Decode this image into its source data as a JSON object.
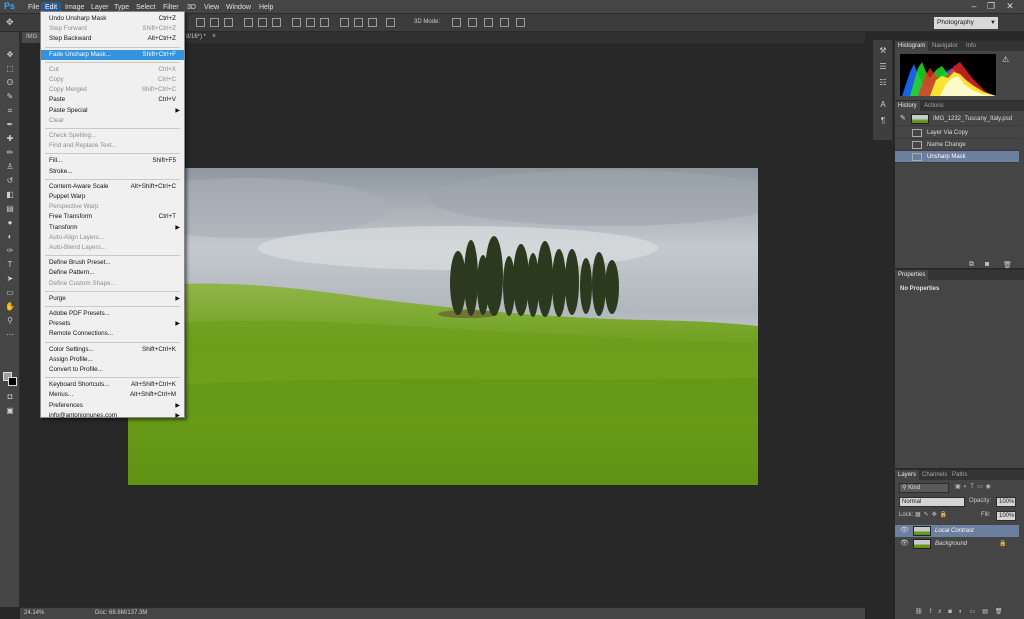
{
  "app": {
    "logo": "Ps"
  },
  "menubar": {
    "items": [
      "File",
      "Edit",
      "Image",
      "Layer",
      "Type",
      "Select",
      "Filter",
      "3D",
      "View",
      "Window",
      "Help"
    ],
    "active": "Edit",
    "window_controls": [
      "minimize-icon",
      "restore-icon",
      "close-icon"
    ]
  },
  "options_bar": {
    "mode_3d_label": "3D Mode:",
    "workspace": "Photography"
  },
  "document": {
    "tab_left": "IMG",
    "tab_right": "8/16*) *",
    "zoom": "24.14%",
    "doc_info": "Doc: 68.6M/137.3M"
  },
  "edit_menu": {
    "items": [
      {
        "label": "Undo Unsharp Mask",
        "shortcut": "Ctrl+Z",
        "state": "enabled"
      },
      {
        "label": "Step Forward",
        "shortcut": "Shift+Ctrl+Z",
        "state": "disabled"
      },
      {
        "label": "Step Backward",
        "shortcut": "Alt+Ctrl+Z",
        "state": "enabled"
      },
      {
        "sep": true
      },
      {
        "label": "Fade Unsharp Mask...",
        "shortcut": "Shift+Ctrl+F",
        "state": "highlighted"
      },
      {
        "sep": true
      },
      {
        "label": "Cut",
        "shortcut": "Ctrl+X",
        "state": "disabled"
      },
      {
        "label": "Copy",
        "shortcut": "Ctrl+C",
        "state": "disabled"
      },
      {
        "label": "Copy Merged",
        "shortcut": "Shift+Ctrl+C",
        "state": "disabled"
      },
      {
        "label": "Paste",
        "shortcut": "Ctrl+V",
        "state": "enabled"
      },
      {
        "label": "Paste Special",
        "shortcut": "",
        "submenu": true,
        "state": "enabled"
      },
      {
        "label": "Clear",
        "shortcut": "",
        "state": "disabled"
      },
      {
        "sep": true
      },
      {
        "label": "Check Spelling...",
        "shortcut": "",
        "state": "disabled"
      },
      {
        "label": "Find and Replace Text...",
        "shortcut": "",
        "state": "disabled"
      },
      {
        "sep": true
      },
      {
        "label": "Fill...",
        "shortcut": "Shift+F5",
        "state": "enabled"
      },
      {
        "label": "Stroke...",
        "shortcut": "",
        "state": "enabled"
      },
      {
        "sep": true
      },
      {
        "label": "Content-Aware Scale",
        "shortcut": "Alt+Shift+Ctrl+C",
        "state": "enabled"
      },
      {
        "label": "Puppet Warp",
        "shortcut": "",
        "state": "enabled"
      },
      {
        "label": "Perspective Warp",
        "shortcut": "",
        "state": "disabled"
      },
      {
        "label": "Free Transform",
        "shortcut": "Ctrl+T",
        "state": "enabled"
      },
      {
        "label": "Transform",
        "shortcut": "",
        "submenu": true,
        "state": "enabled"
      },
      {
        "label": "Auto-Align Layers...",
        "shortcut": "",
        "state": "disabled"
      },
      {
        "label": "Auto-Blend Layers...",
        "shortcut": "",
        "state": "disabled"
      },
      {
        "sep": true
      },
      {
        "label": "Define Brush Preset...",
        "shortcut": "",
        "state": "enabled"
      },
      {
        "label": "Define Pattern...",
        "shortcut": "",
        "state": "enabled"
      },
      {
        "label": "Define Custom Shape...",
        "shortcut": "",
        "state": "disabled"
      },
      {
        "sep": true
      },
      {
        "label": "Purge",
        "shortcut": "",
        "submenu": true,
        "state": "enabled"
      },
      {
        "sep": true
      },
      {
        "label": "Adobe PDF Presets...",
        "shortcut": "",
        "state": "enabled"
      },
      {
        "label": "Presets",
        "shortcut": "",
        "submenu": true,
        "state": "enabled"
      },
      {
        "label": "Remote Connections...",
        "shortcut": "",
        "state": "enabled"
      },
      {
        "sep": true
      },
      {
        "label": "Color Settings...",
        "shortcut": "Shift+Ctrl+K",
        "state": "enabled"
      },
      {
        "label": "Assign Profile...",
        "shortcut": "",
        "state": "enabled"
      },
      {
        "label": "Convert to Profile...",
        "shortcut": "",
        "state": "enabled"
      },
      {
        "sep": true
      },
      {
        "label": "Keyboard Shortcuts...",
        "shortcut": "Alt+Shift+Ctrl+K",
        "state": "enabled"
      },
      {
        "label": "Menus...",
        "shortcut": "Alt+Shift+Ctrl+M",
        "state": "enabled"
      },
      {
        "label": "Preferences",
        "shortcut": "",
        "submenu": true,
        "state": "enabled"
      },
      {
        "label": "info@antonionunes.com",
        "shortcut": "",
        "submenu": true,
        "state": "enabled"
      }
    ]
  },
  "histogram_panel": {
    "tabs": [
      "Histogram",
      "Navigator",
      "Info"
    ]
  },
  "history_panel": {
    "tabs": [
      "History",
      "Actions"
    ],
    "snapshot": "IMG_1232_Tuscany_Italy.psd",
    "states": [
      "Layer Via Copy",
      "Name Change",
      "Unsharp Mask"
    ],
    "selected": "Unsharp Mask"
  },
  "properties_panel": {
    "tabs": [
      "Properties"
    ],
    "message": "No Properties"
  },
  "layers_panel": {
    "tabs": [
      "Layers",
      "Channels",
      "Paths"
    ],
    "filter": "Kind",
    "blend_mode": "Normal",
    "opacity_label": "Opacity:",
    "opacity": "100%",
    "lock_label": "Lock:",
    "fill_label": "Fill:",
    "fill": "100%",
    "layers": [
      {
        "name": "Local Contrast",
        "selected": true
      },
      {
        "name": "Background",
        "selected": false
      }
    ]
  },
  "colors": {
    "menu_highlight": "#3393df",
    "selection": "#6b7f9e",
    "panel_bg": "#454545"
  }
}
